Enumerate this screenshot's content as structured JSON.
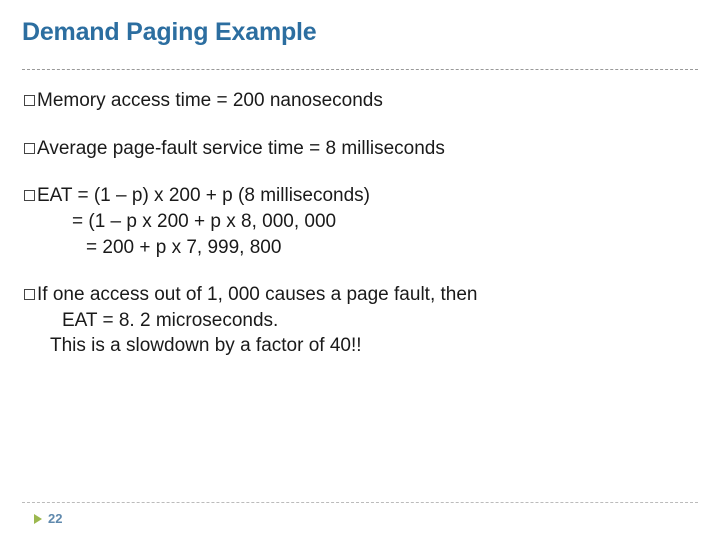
{
  "title": "Demand Paging Example",
  "bullets": {
    "b1_lead": "Memory",
    "b1_rest": " access time = 200 nanoseconds",
    "b2_lead": "Average",
    "b2_rest": " page-fault service time = 8 milliseconds",
    "b3_lead": "EAT",
    "b3_line1_rest": " = (1 – p) x 200 + p (8 milliseconds)",
    "b3_line2": "= (1 – p  x 200 + p x 8, 000, 000",
    "b3_line3": "= 200 + p x 7, 999, 800",
    "b4_lead": "If",
    "b4_line1_rest": " one access out of 1, 000 causes a page fault, then",
    "b4_line2": "EAT = 8. 2 microseconds.",
    "b4_line3": "This is a slowdown by a factor of 40!!"
  },
  "page_number": "22"
}
